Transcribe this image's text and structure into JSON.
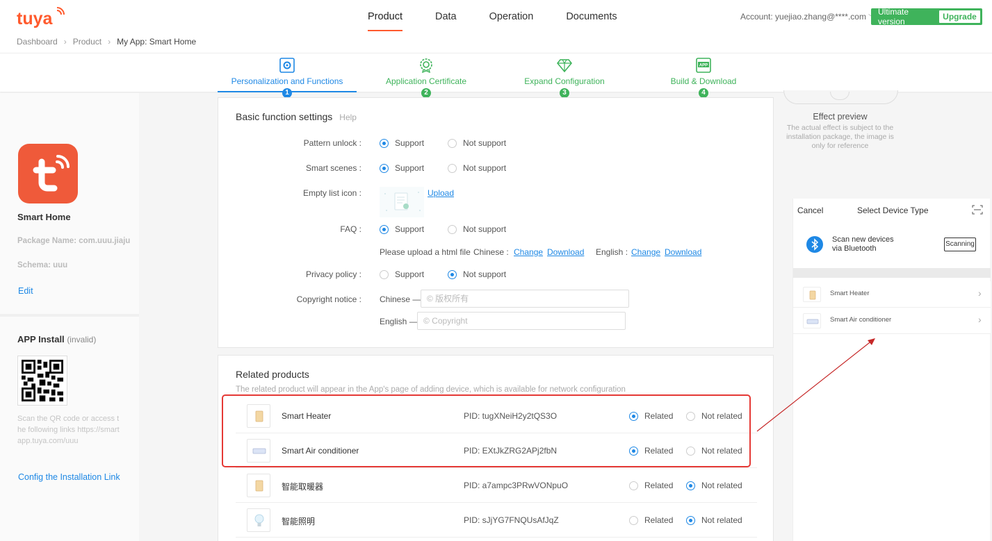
{
  "header": {
    "nav": [
      "Product",
      "Data",
      "Operation",
      "Documents"
    ],
    "account": "Account: yuejiao.zhang@****.com",
    "version": "Ultimate version",
    "upgrade": "Upgrade",
    "breadcrumb": [
      "Dashboard",
      "Product",
      "My App: Smart Home"
    ]
  },
  "steps": [
    {
      "label": "Personalization and Functions",
      "num": "1",
      "icon": "gear-icon"
    },
    {
      "label": "Application Certificate",
      "num": "2",
      "icon": "certificate-icon"
    },
    {
      "label": "Expand Configuration",
      "num": "3",
      "icon": "diamond-icon"
    },
    {
      "label": "Build & Download",
      "num": "4",
      "icon": "app-icon"
    }
  ],
  "left": {
    "app_name": "Smart Home",
    "package": "Package Name: com.uuu.jiaju",
    "schema": "Schema: uuu",
    "edit": "Edit",
    "install_title": "APP Install",
    "install_status": "(invalid)",
    "qr_note": "Scan the QR code or access the following links https://smartapp.tuya.com/uuu",
    "config_link": "Config the Installation Link"
  },
  "basic": {
    "title": "Basic function settings",
    "help": "Help",
    "pattern_unlock": "Pattern unlock :",
    "smart_scenes": "Smart scenes :",
    "empty_list_icon": "Empty list icon :",
    "upload": "Upload",
    "faq": "FAQ :",
    "support": "Support",
    "not_support": "Not support",
    "upload_html": "Please upload a html file",
    "chinese_colon": "Chinese :",
    "english_colon": "English :",
    "change": "Change",
    "download": "Download",
    "privacy_policy": "Privacy policy :",
    "copyright_notice": "Copyright notice :",
    "chinese_dash": "Chinese —",
    "english_dash": "English —",
    "placeholder_cn": "© 版权所有",
    "placeholder_en": "© Copyright"
  },
  "related": {
    "title": "Related products",
    "desc": "The related product will appear in the App's page of adding device, which is available for network configuration",
    "related": "Related",
    "not_related": "Not related",
    "products": [
      {
        "name": "Smart Heater",
        "pid": "PID: tugXNeiH2y2tQS3O",
        "related": true
      },
      {
        "name": "Smart Air conditioner",
        "pid": "PID: EXtJkZRG2APj2fbN",
        "related": true
      },
      {
        "name": "智能取暖器",
        "pid": "PID: a7ampc3PRwVONpuO",
        "related": false
      },
      {
        "name": "智能照明",
        "pid": "PID: sJjYG7FNQUsAfJqZ",
        "related": false
      }
    ]
  },
  "preview": {
    "title": "Effect preview",
    "note": "The actual effect is subject to the installation package, the image is only for reference",
    "cancel": "Cancel",
    "select_title": "Select Device Type",
    "bt_line1": "Scan new devices",
    "bt_line2": "via Bluetooth",
    "scanning": "Scanning",
    "items": [
      "Smart Heater",
      "Smart Air conditioner"
    ]
  },
  "colors": {
    "brand": "#ff5a2d",
    "primary": "#1e88e5",
    "green": "#3fb35b",
    "highlight": "#e53935"
  }
}
